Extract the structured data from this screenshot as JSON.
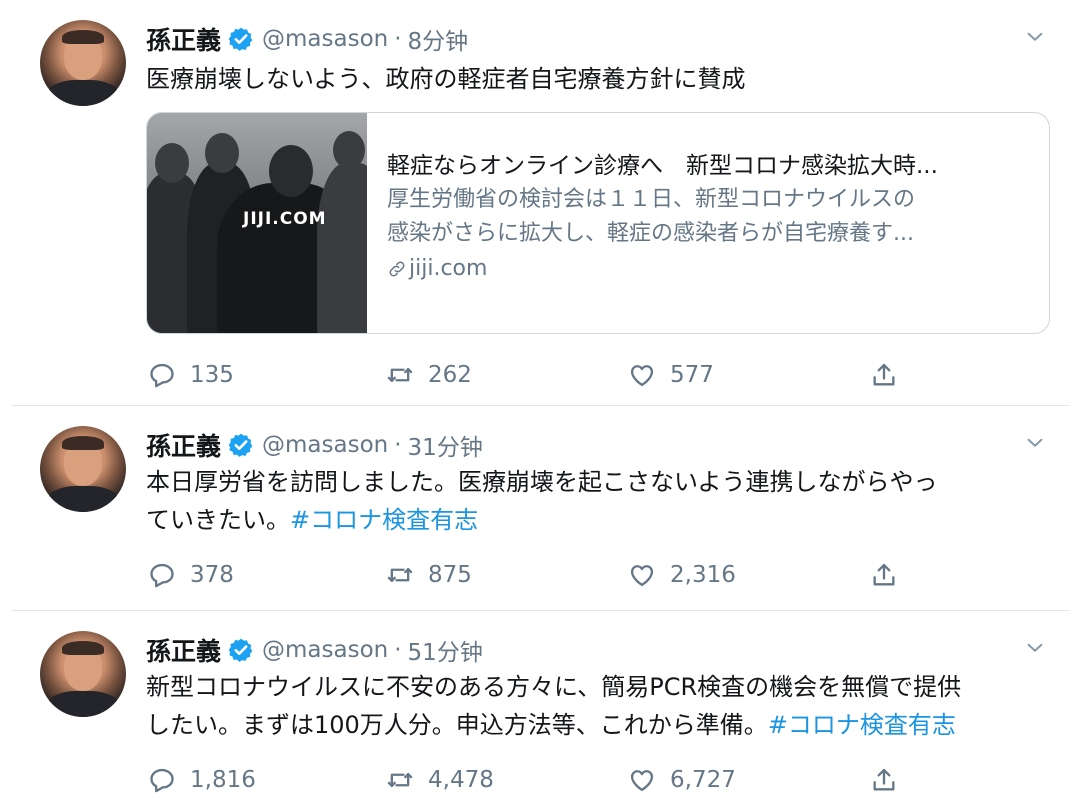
{
  "tweets": [
    {
      "name": "孫正義",
      "handle": "@masason",
      "separator": "·",
      "time": "8分钟",
      "text": "医療崩壊しないよう、政府の軽症者自宅療養方針に賛成",
      "card": {
        "watermark": "JIJI.COM",
        "title": "軽症ならオンライン診療へ　新型コロナ感染拡大時...",
        "desc_line1": "厚生労働省の検討会は１１日、新型コロナウイルスの",
        "desc_line2": "感染がさらに拡大し、軽症の感染者らが自宅療養す...",
        "domain": "jiji.com"
      },
      "replies": "135",
      "retweets": "262",
      "likes": "577"
    },
    {
      "name": "孫正義",
      "handle": "@masason",
      "separator": "·",
      "time": "31分钟",
      "text_line1": "本日厚労省を訪問しました。医療崩壊を起こさないよう連携しながらやっ",
      "text_line2": "ていきたい。",
      "hashtag": "#コロナ検査有志",
      "replies": "378",
      "retweets": "875",
      "likes": "2,316"
    },
    {
      "name": "孫正義",
      "handle": "@masason",
      "separator": "·",
      "time": "51分钟",
      "text_line1": "新型コロナウイルスに不安のある方々に、簡易PCR検査の機会を無償で提供",
      "text_line2": "したい。まずは100万人分。申込方法等、これから準備。",
      "hashtag": "#コロナ検査有志",
      "replies": "1,816",
      "retweets": "4,478",
      "likes": "6,727"
    }
  ],
  "colors": {
    "accent": "#1b95e0",
    "secondary_text": "#657786",
    "verified": "#1da1f2",
    "divider": "#e1e8ed"
  },
  "icons": [
    "verified-badge-icon",
    "chevron-down-icon",
    "reply-icon",
    "retweet-icon",
    "like-icon",
    "share-icon",
    "link-icon"
  ]
}
